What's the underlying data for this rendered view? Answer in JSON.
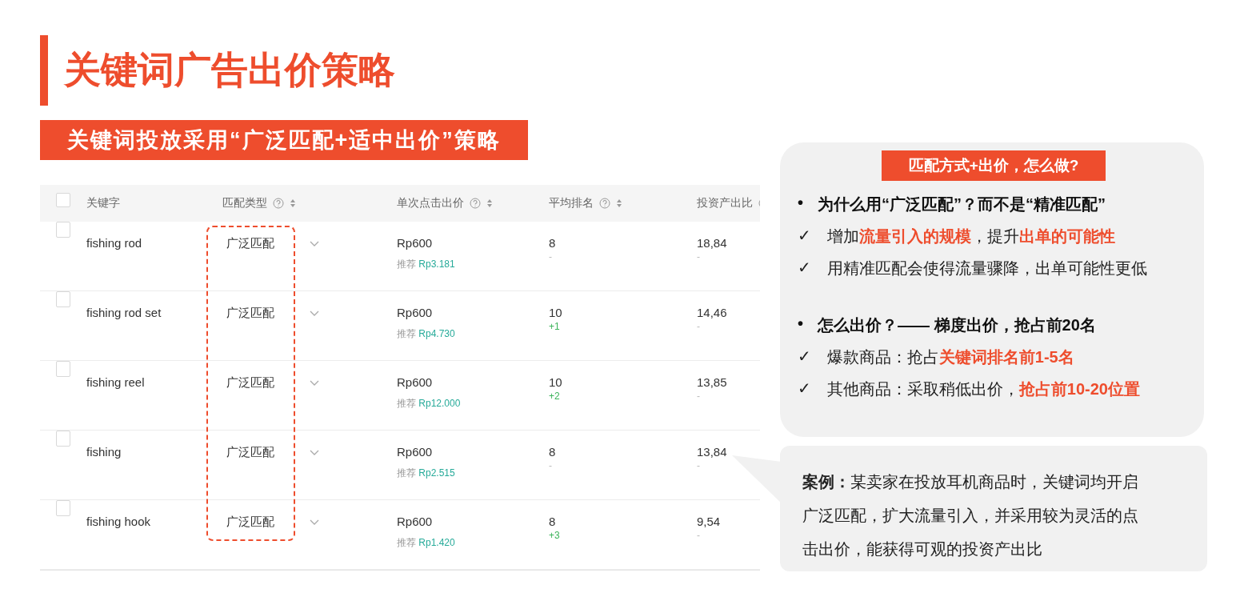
{
  "title": "关键词广告出价策略",
  "subtitle": "关键词投放采用“广泛匹配+适中出价”策略",
  "table": {
    "select_all": {
      "checked": false
    },
    "columns": [
      {
        "label": "关键字",
        "kind": "plain"
      },
      {
        "label": "匹配类型",
        "kind": "help_sort"
      },
      {
        "label": "单次点击出价",
        "kind": "help_sort"
      },
      {
        "label": "平均排名",
        "kind": "help_sort"
      },
      {
        "label": "投资产出比",
        "kind": "help"
      }
    ],
    "rows": [
      {
        "checked": false,
        "keyword": "fishing rod",
        "match": "广泛匹配",
        "bid": "Rp600",
        "suggest_label": "推荐",
        "suggest": "Rp3.181",
        "rank": "8",
        "rank_change": {
          "text": "-",
          "kind": "none"
        },
        "roi": "18,84",
        "roi_change": "-"
      },
      {
        "checked": false,
        "keyword": "fishing rod set",
        "match": "广泛匹配",
        "bid": "Rp600",
        "suggest_label": "推荐",
        "suggest": "Rp4.730",
        "rank": "10",
        "rank_change": {
          "text": "+1",
          "kind": "up"
        },
        "roi": "14,46",
        "roi_change": "-"
      },
      {
        "checked": false,
        "keyword": "fishing reel",
        "match": "广泛匹配",
        "bid": "Rp600",
        "suggest_label": "推荐",
        "suggest": "Rp12.000",
        "rank": "10",
        "rank_change": {
          "text": "+2",
          "kind": "up"
        },
        "roi": "13,85",
        "roi_change": "-"
      },
      {
        "checked": false,
        "keyword": "fishing",
        "match": "广泛匹配",
        "bid": "Rp600",
        "suggest_label": "推荐",
        "suggest": "Rp2.515",
        "rank": "8",
        "rank_change": {
          "text": "-",
          "kind": "none"
        },
        "roi": "13,84",
        "roi_change": "-"
      },
      {
        "checked": false,
        "keyword": "fishing hook",
        "match": "广泛匹配",
        "bid": "Rp600",
        "suggest_label": "推荐",
        "suggest": "Rp1.420",
        "rank": "8",
        "rank_change": {
          "text": "+3",
          "kind": "up"
        },
        "roi": "9,54",
        "roi_change": "-"
      }
    ]
  },
  "tips": {
    "heading": "匹配方式+出价，怎么做?",
    "sections": [
      {
        "bullet": "•",
        "heading": "为什么用“广泛匹配”？而不是“精准匹配”",
        "items": [
          {
            "mark": "✓",
            "text": "增加**流量引入的规模**，提升**出单的可能性**"
          },
          {
            "mark": "✓",
            "text": "用精准匹配会使得流量骤降，出单可能性更低"
          }
        ]
      },
      {
        "bullet": "•",
        "heading": "怎么出价？—— 梯度出价，抢占前20名",
        "items": [
          {
            "mark": "✓",
            "text": "爆款商品：抢占**关键词排名前1-5名**"
          },
          {
            "mark": "✓",
            "text": "其他商品：采取稍低出价，**抢占前10-20位置**"
          }
        ]
      }
    ]
  },
  "case": {
    "text": "**案例：**某卖家在投放耳机商品时，关键词均开启广泛匹配，扩大流量引入，并采用较为灵活的点击出价，能获得可观的投资产出比"
  }
}
